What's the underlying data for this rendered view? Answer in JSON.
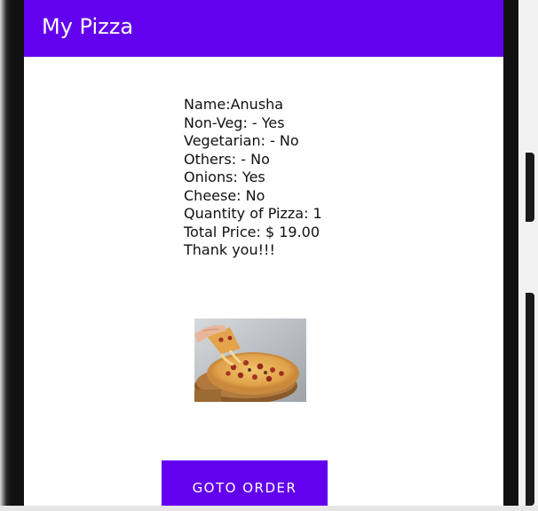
{
  "app_bar": {
    "title": "My Pizza",
    "color": "#6200ee"
  },
  "order_summary": {
    "lines": [
      "Name:Anusha",
      "Non-Veg: - Yes",
      "Vegetarian: - No",
      "Others: - No",
      "Onions: Yes",
      "Cheese: No",
      "Quantity of Pizza: 1",
      "Total Price: $ 19.00",
      "Thank you!!!"
    ]
  },
  "image": {
    "subject": "pizza-photo"
  },
  "actions": {
    "goto_order_label": "GOTO ORDER",
    "button_color": "#6200ee"
  }
}
